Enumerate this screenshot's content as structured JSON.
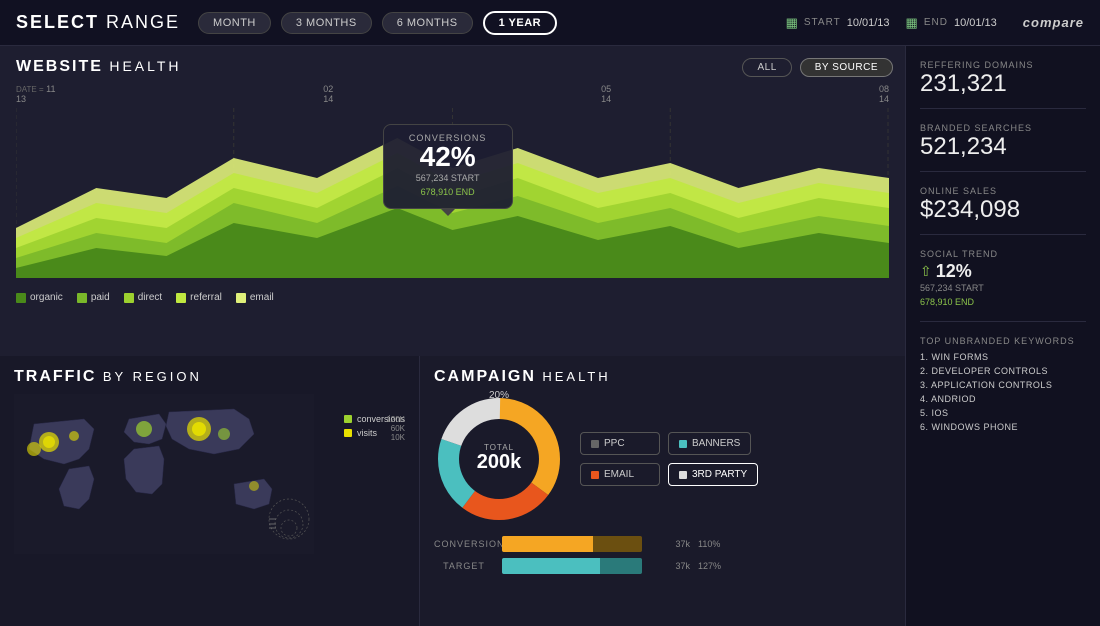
{
  "header": {
    "title_regular": "SELECT",
    "title_bold": "RANGE",
    "range_buttons": [
      {
        "label": "MONTH",
        "active": false
      },
      {
        "label": "3 MONTHS",
        "active": false
      },
      {
        "label": "6 MONTHS",
        "active": false
      },
      {
        "label": "1 YEAR",
        "active": true
      }
    ],
    "start_label": "START",
    "start_date": "10/01/13",
    "end_label": "END",
    "end_date": "10/01/13",
    "compare_label": "compare"
  },
  "website_health": {
    "title_regular": "WEBSITE",
    "title_bold": "HEALTH",
    "btn_all": "ALL",
    "btn_source": "BY SOURCE",
    "dates": [
      "11\n13",
      "02\n14",
      "05\n14",
      "08\n14"
    ],
    "tooltip": {
      "title": "CONVERSIONS",
      "pct": "42%",
      "start_label": "567,234 START",
      "end_label": "678,910 END"
    },
    "legend": [
      {
        "color": "#6db33f",
        "label": "organic"
      },
      {
        "color": "#9dd12f",
        "label": "paid"
      },
      {
        "color": "#c0e840",
        "label": "direct"
      },
      {
        "color": "#dff07a",
        "label": "referral"
      },
      {
        "color": "#eee",
        "label": "email"
      }
    ]
  },
  "traffic": {
    "title_regular": "TRAFFIC",
    "title_bold": "BY REGION",
    "legend": [
      {
        "color": "#9dd12f",
        "label": "conversions"
      },
      {
        "color": "#e8e000",
        "label": "visits"
      }
    ],
    "scale": [
      "120K",
      "60K",
      "10K"
    ]
  },
  "campaign": {
    "title_regular": "CAMPAIGN",
    "title_bold": "HEALTH",
    "donut_pct": "20%",
    "donut_total_label": "TOTAL",
    "donut_total_value": "200k",
    "segments": [
      {
        "color": "#f5a623",
        "pct": 35
      },
      {
        "color": "#e8561d",
        "pct": 25
      },
      {
        "color": "#4bbfbf",
        "pct": 20
      },
      {
        "color": "#eee",
        "pct": 20
      }
    ],
    "buttons": [
      {
        "color": "#555",
        "label": "PPC",
        "active": false
      },
      {
        "color": "#4bbfbf",
        "label": "BANNERS",
        "active": false
      },
      {
        "color": "#e8561d",
        "label": "EMAIL",
        "active": false
      },
      {
        "color": "#eee",
        "label": "3RD PARTY",
        "active": true
      }
    ],
    "bars": [
      {
        "label": "CONVERSION",
        "value": "37k",
        "pct": "110%",
        "fill1_color": "#f5a623",
        "fill1_w": 60,
        "fill2_color": "#8b6914",
        "fill2_w": 40,
        "track_color": "#333"
      },
      {
        "label": "TARGET",
        "value": "37k",
        "pct": "127%",
        "fill1_color": "#4bbfbf",
        "fill1_w": 70,
        "fill2_color": "#2a7a7a",
        "fill2_w": 30,
        "track_color": "#333"
      }
    ]
  },
  "stats": {
    "referring_domains": {
      "label": "REFFERING DOMAINS",
      "value": "231,321"
    },
    "branded_searches": {
      "label": "BRANDED SEARCHES",
      "value": "521,234"
    },
    "online_sales": {
      "label": "ONLINE SALES",
      "value": "$234,098"
    },
    "social_trend": {
      "label": "SOCIAL TREND",
      "pct": "12%",
      "start": "567,234 START",
      "end": "678,910 END"
    },
    "keywords_label": "TOP UNBRANDED KEYWORDS",
    "keywords": [
      "1. WIN FORMS",
      "2. DEVELOPER CONTROLS",
      "3. APPLICATION CONTROLS",
      "4. ANDRIOD",
      "5. IOS",
      "6. WINDOWS PHONE"
    ]
  }
}
